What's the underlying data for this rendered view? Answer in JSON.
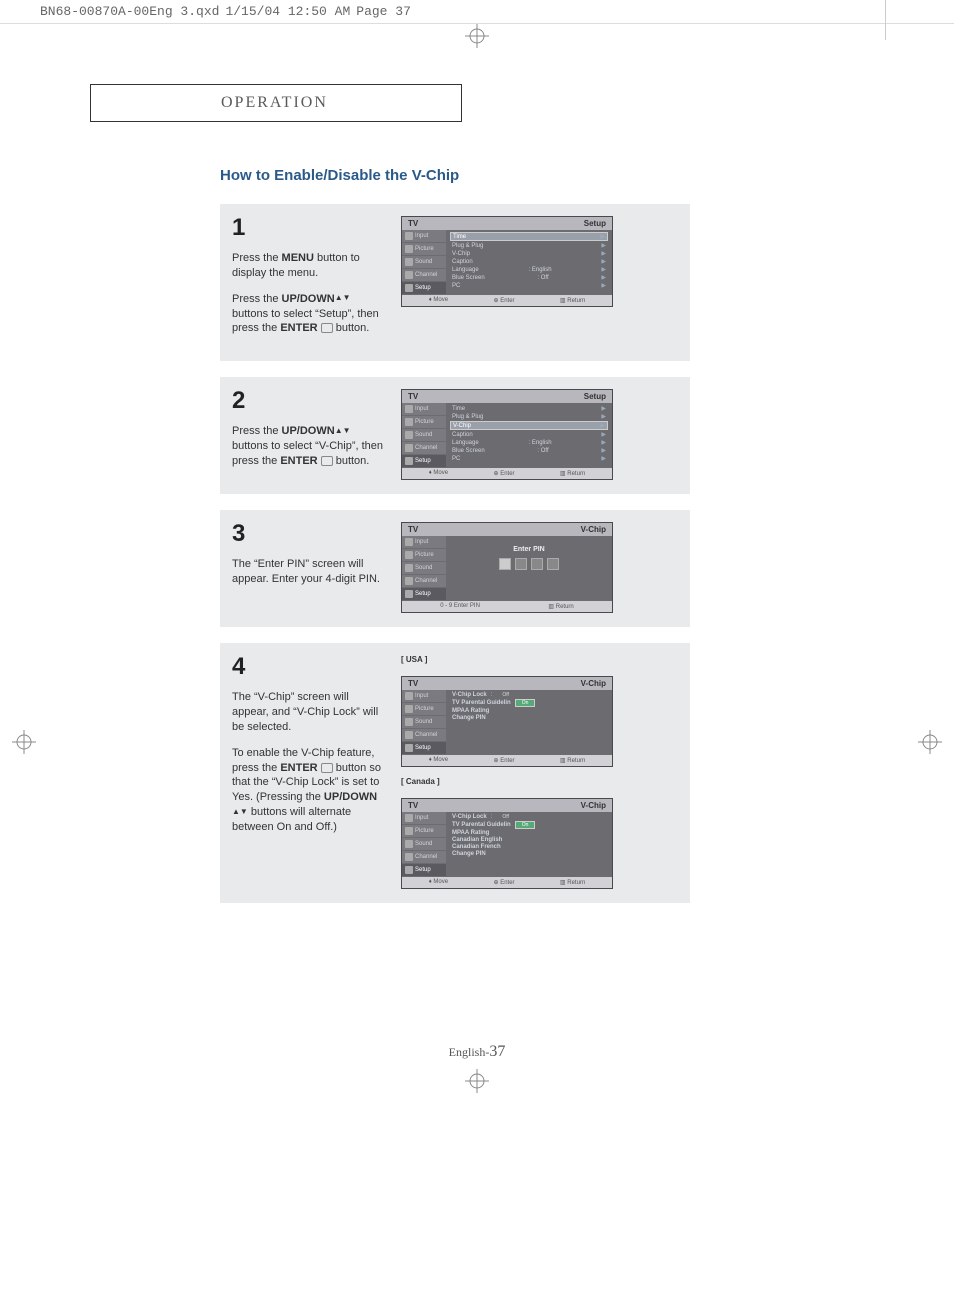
{
  "doc_header": {
    "file": "BN68-00870A-00Eng 3.qxd",
    "date": "1/15/04 12:50 AM",
    "page_label": "Page 37"
  },
  "chapter": "OPERATION",
  "title": "How to Enable/Disable the V-Chip",
  "steps": {
    "s1": {
      "num": "1",
      "p1a": "Press the ",
      "p1b": "MENU",
      "p1c": " button to display the menu.",
      "p2a": "Press the ",
      "p2b": "UP/DOWN",
      "p2c": " buttons to select “Setup”, then press the ",
      "p2d": "ENTER",
      "p2e": " button."
    },
    "s2": {
      "num": "2",
      "p1a": "Press the ",
      "p1b": "UP/DOWN",
      "p1c": " buttons to select “V-Chip”, then press the ",
      "p1d": "ENTER",
      "p1e": " button."
    },
    "s3": {
      "num": "3",
      "p1": "The “Enter PIN” screen will appear. Enter your 4-digit PIN."
    },
    "s4": {
      "num": "4",
      "p1": "The “V-Chip” screen will appear, and “V-Chip Lock” will be selected.",
      "p2a": "To enable the V-Chip feature, press the ",
      "p2b": "ENTER",
      "p2c": " button so that the “V-Chip Lock” is set to Yes.  (Pressing the ",
      "p2d": "UP/DOWN",
      "p2e": " buttons will alternate between On and Off.)"
    }
  },
  "osd": {
    "tv": "TV",
    "setup": "Setup",
    "vchip": "V-Chip",
    "side": [
      "Input",
      "Picture",
      "Sound",
      "Channel",
      "Setup"
    ],
    "setup_items": [
      {
        "l": "Time",
        "v": ""
      },
      {
        "l": "Plug & Plug",
        "v": ""
      },
      {
        "l": "V-Chip",
        "v": ""
      },
      {
        "l": "Caption",
        "v": ""
      },
      {
        "l": "Language",
        "v": ": English"
      },
      {
        "l": "Blue Screen",
        "v": ": Off"
      },
      {
        "l": "PC",
        "v": ""
      }
    ],
    "enter_pin": "Enter PIN",
    "foot_move": "Move",
    "foot_enter": "Enter",
    "foot_return": "Return",
    "foot_pin": "0 - 9 Enter PIN",
    "usa_label": "[ USA ]",
    "canada_label": "[ Canada ]",
    "vchip_usa": [
      {
        "l": "V-Chip Lock",
        "off": "Off",
        "on": "On"
      },
      {
        "l": "TV Parental Guidelin"
      },
      {
        "l": "MPAA Rating"
      },
      {
        "l": "Change PIN"
      }
    ],
    "vchip_can": [
      {
        "l": "V-Chip Lock",
        "off": "Off",
        "on": "On"
      },
      {
        "l": "TV Parental Guidelin"
      },
      {
        "l": "MPAA Rating"
      },
      {
        "l": "Canadian English"
      },
      {
        "l": "Canadian French"
      },
      {
        "l": "Change PIN"
      }
    ]
  },
  "footer": {
    "lang": "English-",
    "num": "37"
  }
}
